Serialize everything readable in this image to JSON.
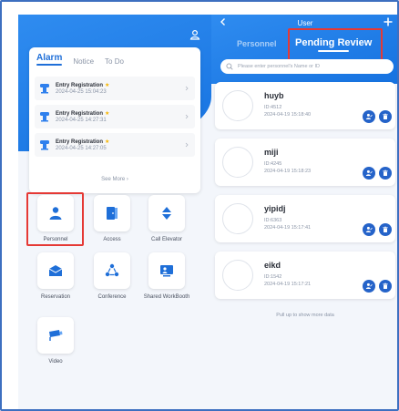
{
  "left": {
    "alarm_tabs": [
      {
        "label": "Alarm",
        "active": true
      },
      {
        "label": "Notice",
        "active": false
      },
      {
        "label": "To Do",
        "active": false
      }
    ],
    "alarms": [
      {
        "title": "Entry Registration",
        "time": "2024-04-25 15:04:23"
      },
      {
        "title": "Entry Registration",
        "time": "2024-04-25 14:27:31"
      },
      {
        "title": "Entry Registration",
        "time": "2024-04-25 14:27:05"
      }
    ],
    "see_more": "See More",
    "grid": [
      {
        "label": "Personnel",
        "icon": "person-icon"
      },
      {
        "label": "Access",
        "icon": "door-icon"
      },
      {
        "label": "Call Elevator",
        "icon": "elevator-icon"
      },
      {
        "label": "Reservation",
        "icon": "reservation-icon"
      },
      {
        "label": "Conference",
        "icon": "conference-icon"
      },
      {
        "label": "Shared WorkBooth",
        "icon": "workbooth-icon"
      },
      {
        "label": "Video",
        "icon": "camera-icon"
      }
    ]
  },
  "right": {
    "title": "User",
    "tabs": [
      {
        "label": "Personnel",
        "active": false
      },
      {
        "label": "Pending Review",
        "active": true
      }
    ],
    "search_placeholder": "Please enter personnel's Name or ID",
    "people": [
      {
        "name": "huyb",
        "id": "ID:4512",
        "date": "2024-04-19 15:18:40"
      },
      {
        "name": "miji",
        "id": "ID:4245",
        "date": "2024-04-19 15:18:23"
      },
      {
        "name": "yipidj",
        "id": "ID:6363",
        "date": "2024-04-19 15:17:41"
      },
      {
        "name": "eikd",
        "id": "ID:1542",
        "date": "2024-04-19 15:17:21"
      }
    ],
    "pull_more": "Pull up to show more data"
  },
  "colors": {
    "brand_blue": "#1f6fd8",
    "highlight_red": "#e53935",
    "star_yellow": "#f7b500",
    "action_blue": "#2563c9"
  }
}
